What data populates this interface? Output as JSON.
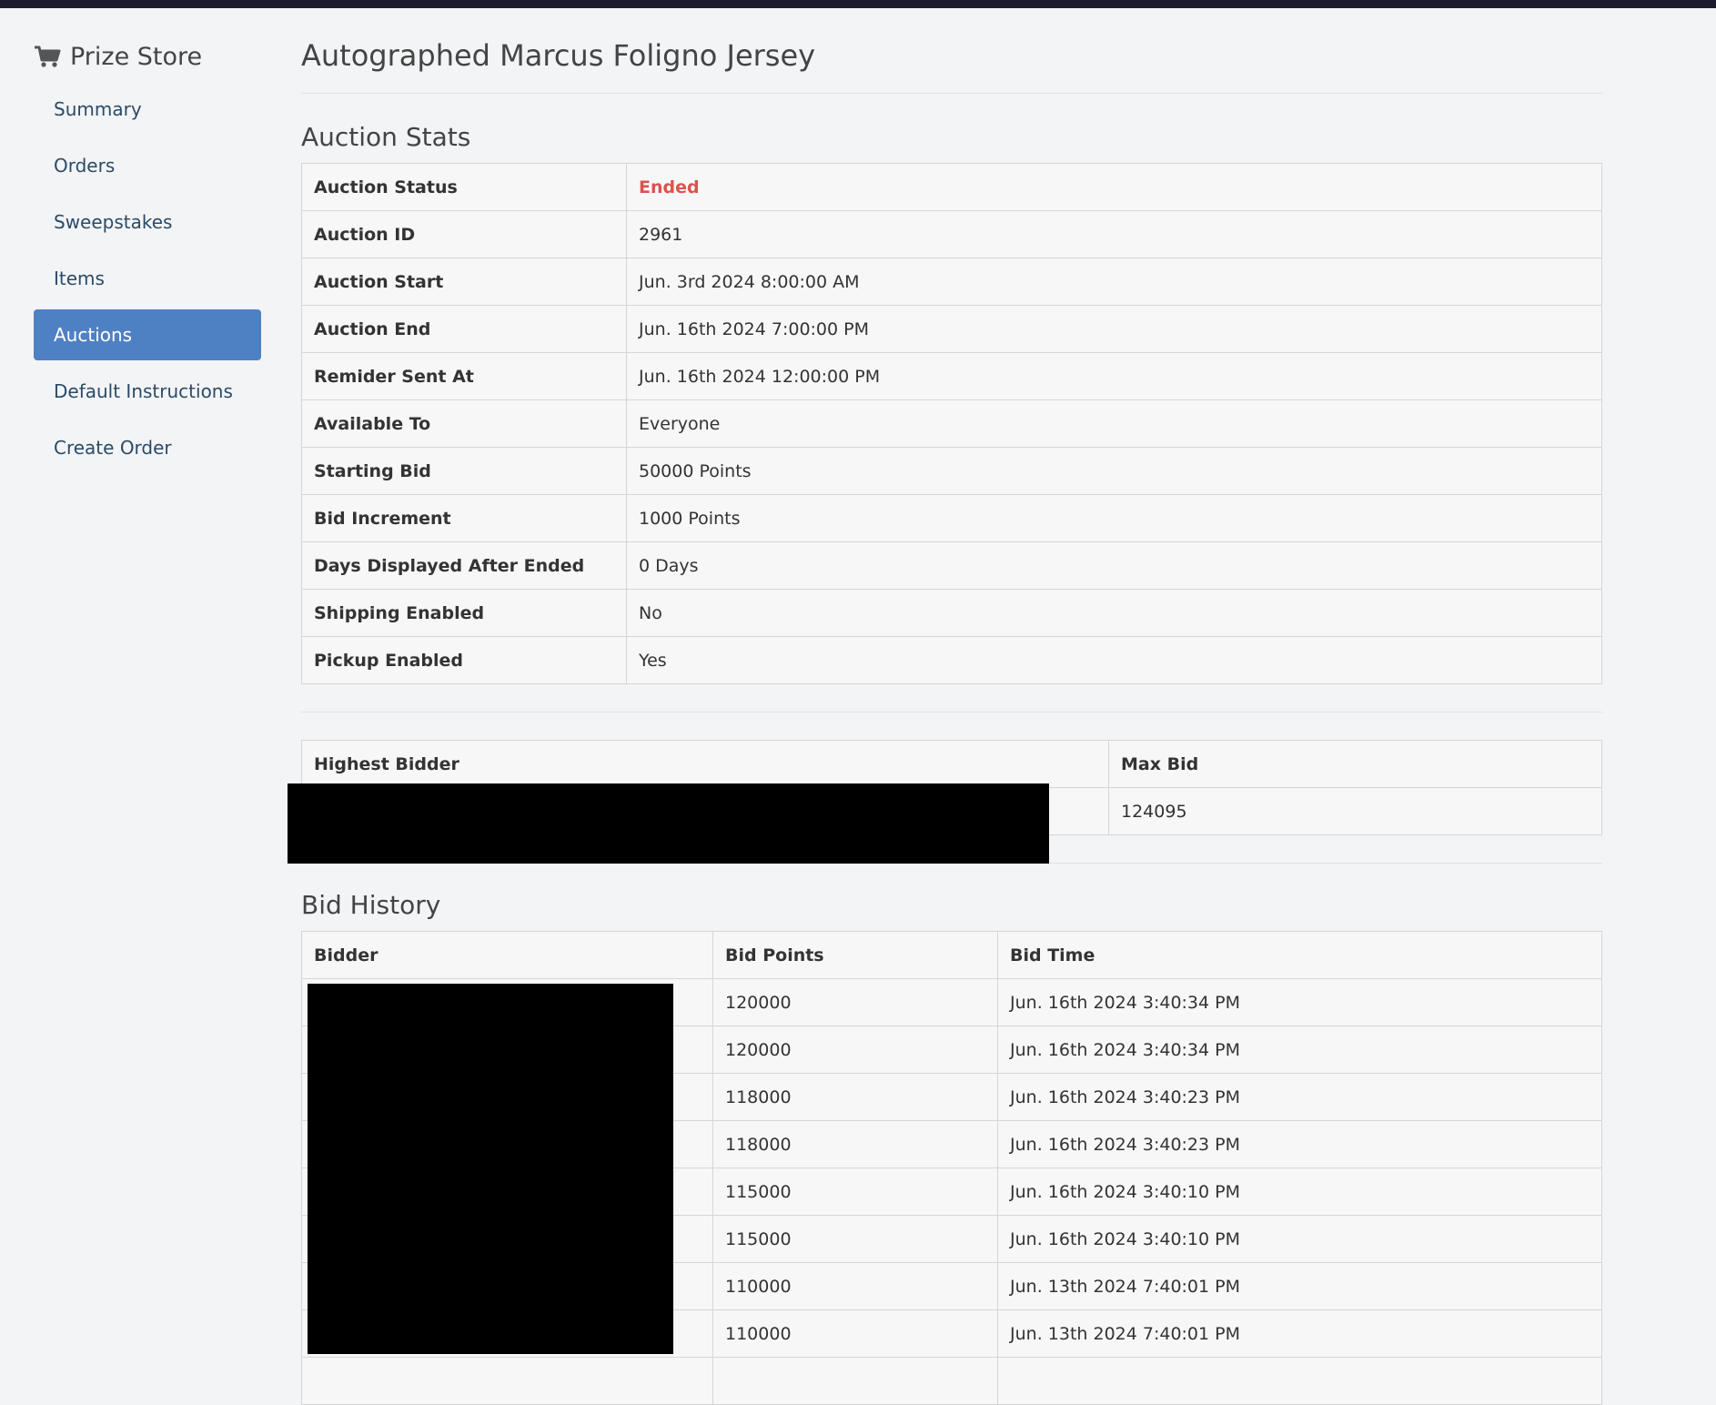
{
  "sidebar": {
    "brand": "Prize Store",
    "brand_icon": "shopping-cart-icon",
    "items": [
      {
        "label": "Summary",
        "active": false
      },
      {
        "label": "Orders",
        "active": false
      },
      {
        "label": "Sweepstakes",
        "active": false
      },
      {
        "label": "Items",
        "active": false
      },
      {
        "label": "Auctions",
        "active": true
      },
      {
        "label": "Default Instructions",
        "active": false
      },
      {
        "label": "Create Order",
        "active": false
      }
    ]
  },
  "page": {
    "title": "Autographed Marcus Foligno Jersey"
  },
  "stats": {
    "heading": "Auction Stats",
    "rows": [
      {
        "key": "Auction Status",
        "value": "Ended"
      },
      {
        "key": "Auction ID",
        "value": "2961"
      },
      {
        "key": "Auction Start",
        "value": "Jun. 3rd 2024 8:00:00 AM"
      },
      {
        "key": "Auction End",
        "value": "Jun. 16th 2024 7:00:00 PM"
      },
      {
        "key": "Remider Sent At",
        "value": "Jun. 16th 2024 12:00:00 PM"
      },
      {
        "key": "Available To",
        "value": "Everyone"
      },
      {
        "key": "Starting Bid",
        "value": "50000 Points"
      },
      {
        "key": "Bid Increment",
        "value": "1000 Points"
      },
      {
        "key": "Days Displayed After Ended",
        "value": "0 Days"
      },
      {
        "key": "Shipping Enabled",
        "value": "No"
      },
      {
        "key": "Pickup Enabled",
        "value": "Yes"
      }
    ],
    "status_color": "#d9534f"
  },
  "highest": {
    "headers": [
      "Highest Bidder",
      "Max Bid"
    ],
    "max_bid": "124095"
  },
  "history": {
    "heading": "Bid History",
    "headers": [
      "Bidder",
      "Bid Points",
      "Bid Time"
    ],
    "rows": [
      {
        "points": "120000",
        "time": "Jun. 16th 2024 3:40:34 PM"
      },
      {
        "points": "120000",
        "time": "Jun. 16th 2024 3:40:34 PM"
      },
      {
        "points": "118000",
        "time": "Jun. 16th 2024 3:40:23 PM"
      },
      {
        "points": "118000",
        "time": "Jun. 16th 2024 3:40:23 PM"
      },
      {
        "points": "115000",
        "time": "Jun. 16th 2024 3:40:10 PM"
      },
      {
        "points": "115000",
        "time": "Jun. 16th 2024 3:40:10 PM"
      },
      {
        "points": "110000",
        "time": "Jun. 13th 2024 7:40:01 PM"
      },
      {
        "points": "110000",
        "time": "Jun. 13th 2024 7:40:01 PM"
      },
      {
        "points": "",
        "time": ""
      }
    ]
  }
}
